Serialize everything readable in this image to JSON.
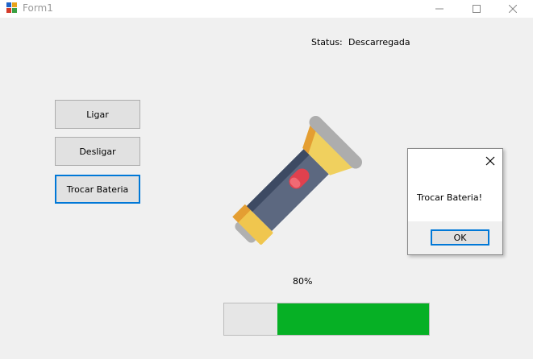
{
  "window": {
    "title": "Form1"
  },
  "status": {
    "label": "Status:",
    "value": "Descarregada"
  },
  "buttons": {
    "ligar": "Ligar",
    "desligar": "Desligar",
    "trocar": "Trocar Bateria"
  },
  "battery": {
    "percent_text": "80%",
    "fill_fraction": 0.74,
    "fill_color": "#06b025"
  },
  "flashlight": {
    "icon": "flashlight-icon"
  },
  "message_box": {
    "text": "Trocar Bateria!",
    "ok_label": "OK"
  },
  "colors": {
    "accent": "#0078d7"
  }
}
